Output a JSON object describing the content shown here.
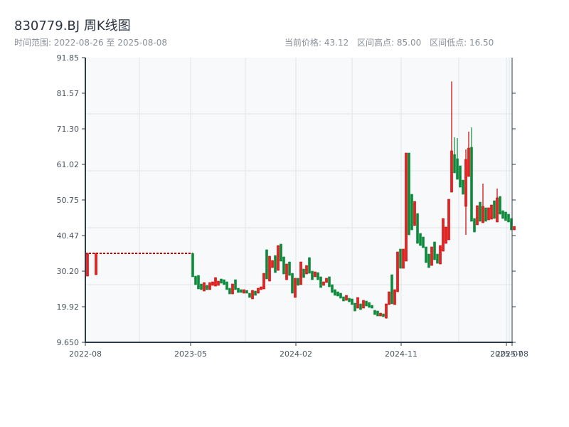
{
  "header": {
    "title": "830779.BJ 周K线图",
    "range_label": "时间范围: 2022-08-26 至 2025-08-08",
    "current_price": "当前价格: 43.12",
    "range_high": "区间高点: 85.00",
    "range_low": "区间低点: 16.50"
  },
  "chart_data": {
    "type": "candlestick",
    "title": "830779.BJ 周K线图",
    "up_color": "#cc0000",
    "down_color": "#0a8a3a",
    "ylim": [
      9.65,
      91.85
    ],
    "y_ticks": [
      "91.85",
      "81.57",
      "71.30",
      "61.02",
      "50.75",
      "40.47",
      "30.20",
      "19.92",
      "9.650"
    ],
    "x_ticks": [
      {
        "label": "2022-08",
        "candle": 0
      },
      {
        "label": "2023-05",
        "candle": 37
      },
      {
        "label": "2024-02",
        "candle": 74
      },
      {
        "label": "2024-11",
        "candle": 111
      },
      {
        "label": "2025-07",
        "candle": 148
      },
      {
        "label": "2025-08",
        "candle": 149
      }
    ],
    "grid": true,
    "suspended_price": 35.34,
    "pre_suspension": [
      {
        "candle": 0,
        "ohlc": [
          28.76,
          35.34,
          28.76,
          35.34
        ]
      },
      {
        "candle": 3,
        "ohlc": [
          29.17,
          35.34,
          29.17,
          35.34
        ]
      }
    ],
    "first_active_candle": 37,
    "candles": [
      [
        35.34,
        35.34,
        28.56,
        28.56
      ],
      [
        28.76,
        28.76,
        26.3,
        26.3
      ],
      [
        28.97,
        28.97,
        25.06,
        25.06
      ],
      [
        26.5,
        26.5,
        24.86,
        24.86
      ],
      [
        24.45,
        26.91,
        24.45,
        26.91
      ],
      [
        26.09,
        26.09,
        24.86,
        24.86
      ],
      [
        24.86,
        26.91,
        24.86,
        26.91
      ],
      [
        26.09,
        27.12,
        26.09,
        27.12
      ],
      [
        25.88,
        28.35,
        25.88,
        28.35
      ],
      [
        26.09,
        27.32,
        26.09,
        27.32
      ],
      [
        27.94,
        27.94,
        26.71,
        26.71
      ],
      [
        27.73,
        27.73,
        26.3,
        26.3
      ],
      [
        27.12,
        27.12,
        24.86,
        24.86
      ],
      [
        25.27,
        25.27,
        23.62,
        23.62
      ],
      [
        23.62,
        26.5,
        23.62,
        26.5
      ],
      [
        27.73,
        27.73,
        24.86,
        24.86
      ],
      [
        25.27,
        25.27,
        24.04,
        24.04
      ],
      [
        24.86,
        24.86,
        24.04,
        24.04
      ],
      [
        23.83,
        24.86,
        23.83,
        24.86
      ],
      [
        24.65,
        24.65,
        23.83,
        23.83
      ],
      [
        23.83,
        23.83,
        22.6,
        22.6
      ],
      [
        22.19,
        24.65,
        22.19,
        24.65
      ],
      [
        24.45,
        24.45,
        23.21,
        23.21
      ],
      [
        23.83,
        25.27,
        23.83,
        25.27
      ],
      [
        24.86,
        25.68,
        24.86,
        25.68
      ],
      [
        25.06,
        29.58,
        25.06,
        29.58
      ],
      [
        36.37,
        36.37,
        27.94,
        27.94
      ],
      [
        27.32,
        34.52,
        27.32,
        34.52
      ],
      [
        31.23,
        33.28,
        31.23,
        33.28
      ],
      [
        34.72,
        34.72,
        29.79,
        29.79
      ],
      [
        30.41,
        37.6,
        30.41,
        37.6
      ],
      [
        38.01,
        38.01,
        33.08,
        33.08
      ],
      [
        34.31,
        34.31,
        29.38,
        29.38
      ],
      [
        27.73,
        32.26,
        27.73,
        32.26
      ],
      [
        32.87,
        32.87,
        28.97,
        28.97
      ],
      [
        29.58,
        29.58,
        23.83,
        23.83
      ],
      [
        22.6,
        28.15,
        22.6,
        28.15
      ],
      [
        28.15,
        28.15,
        26.09,
        26.09
      ],
      [
        26.3,
        32.87,
        26.3,
        32.87
      ],
      [
        30.82,
        30.82,
        28.35,
        28.35
      ],
      [
        29.38,
        31.84,
        29.38,
        31.84
      ],
      [
        34.11,
        34.11,
        29.58,
        29.58
      ],
      [
        30.2,
        30.2,
        27.73,
        27.73
      ],
      [
        28.56,
        29.99,
        28.56,
        29.99
      ],
      [
        29.79,
        29.79,
        27.73,
        27.73
      ],
      [
        28.56,
        28.56,
        25.47,
        25.47
      ],
      [
        26.09,
        27.12,
        26.09,
        27.12
      ],
      [
        26.91,
        28.15,
        26.91,
        28.15
      ],
      [
        28.56,
        28.56,
        25.68,
        25.68
      ],
      [
        26.3,
        26.3,
        24.04,
        24.04
      ],
      [
        24.86,
        24.86,
        23.21,
        23.21
      ],
      [
        24.24,
        24.24,
        23.01,
        23.01
      ],
      [
        23.83,
        23.83,
        22.39,
        22.39
      ],
      [
        22.8,
        22.8,
        21.57,
        21.57
      ],
      [
        21.77,
        23.21,
        21.77,
        23.21
      ],
      [
        22.39,
        22.39,
        21.36,
        21.36
      ],
      [
        22.19,
        22.19,
        20.54,
        20.54
      ],
      [
        20.95,
        20.95,
        18.69,
        18.69
      ],
      [
        19.51,
        22.6,
        19.51,
        22.6
      ],
      [
        20.75,
        20.75,
        19.1,
        19.1
      ],
      [
        19.51,
        21.77,
        19.51,
        21.77
      ],
      [
        21.57,
        21.57,
        20.13,
        20.13
      ],
      [
        21.16,
        21.16,
        19.72,
        19.72
      ],
      [
        20.34,
        20.34,
        19.51,
        19.51
      ],
      [
        18.9,
        18.9,
        17.66,
        17.66
      ],
      [
        18.69,
        18.69,
        17.25,
        17.25
      ],
      [
        17.25,
        18.08,
        17.25,
        18.08
      ],
      [
        17.87,
        17.87,
        17.05,
        17.05
      ],
      [
        16.64,
        20.75,
        16.5,
        20.75
      ],
      [
        20.54,
        24.24,
        20.54,
        24.24
      ],
      [
        29.17,
        29.17,
        20.75,
        20.75
      ],
      [
        20.54,
        24.86,
        20.54,
        24.86
      ],
      [
        24.24,
        35.75,
        24.24,
        35.75
      ],
      [
        36.57,
        36.57,
        31.02,
        31.02
      ],
      [
        31.02,
        36.57,
        31.02,
        36.57
      ],
      [
        33.08,
        64.31,
        33.08,
        64.31
      ],
      [
        64.31,
        64.31,
        40.68,
        40.68
      ],
      [
        52.39,
        52.39,
        42.12,
        42.12
      ],
      [
        43.35,
        50.34,
        43.35,
        50.34
      ],
      [
        46.85,
        46.85,
        38.21,
        38.21
      ],
      [
        41.09,
        41.09,
        37.6,
        37.6
      ],
      [
        40.06,
        40.06,
        36.98,
        36.98
      ],
      [
        37.19,
        37.19,
        32.67,
        32.67
      ],
      [
        35.13,
        35.13,
        31.23,
        31.23
      ],
      [
        31.84,
        37.19,
        31.84,
        37.19
      ],
      [
        38.63,
        38.63,
        33.49,
        33.49
      ],
      [
        35.13,
        35.13,
        32.46,
        32.46
      ],
      [
        32.26,
        37.6,
        32.26,
        37.6
      ],
      [
        35.95,
        45.41,
        35.95,
        45.41
      ],
      [
        38.21,
        42.94,
        38.21,
        42.94
      ],
      [
        39.24,
        50.96,
        39.24,
        50.96
      ],
      [
        53.01,
        85.0,
        53.01,
        64.93
      ],
      [
        63.9,
        68.83,
        58.56,
        58.56
      ],
      [
        62.67,
        68.63,
        56.71,
        56.71
      ],
      [
        60.61,
        60.61,
        54.45,
        54.45
      ],
      [
        56.5,
        56.5,
        52.39,
        52.39
      ],
      [
        48.9,
        65.34,
        40.68,
        62.46
      ],
      [
        57.53,
        70.48,
        57.53,
        65.75
      ],
      [
        65.96,
        71.71,
        44.59,
        44.59
      ],
      [
        45.41,
        45.41,
        41.5,
        41.5
      ],
      [
        43.56,
        49.11,
        43.56,
        49.11
      ],
      [
        50.13,
        50.13,
        44.59,
        44.59
      ],
      [
        44.17,
        55.47,
        44.17,
        48.9
      ],
      [
        48.49,
        48.49,
        44.59,
        44.59
      ],
      [
        45.0,
        48.49,
        45.0,
        48.49
      ],
      [
        45.2,
        49.31,
        45.2,
        49.31
      ],
      [
        50.54,
        50.54,
        45.41,
        45.41
      ],
      [
        44.38,
        54.04,
        44.38,
        51.37
      ],
      [
        51.78,
        51.78,
        46.64,
        46.64
      ],
      [
        47.67,
        47.67,
        45.41,
        45.41
      ],
      [
        47.26,
        47.26,
        44.79,
        44.79
      ],
      [
        46.64,
        46.64,
        44.38,
        44.38
      ],
      [
        45.41,
        45.41,
        42.12,
        42.12
      ],
      [
        42.12,
        43.12,
        42.12,
        43.12
      ]
    ]
  }
}
